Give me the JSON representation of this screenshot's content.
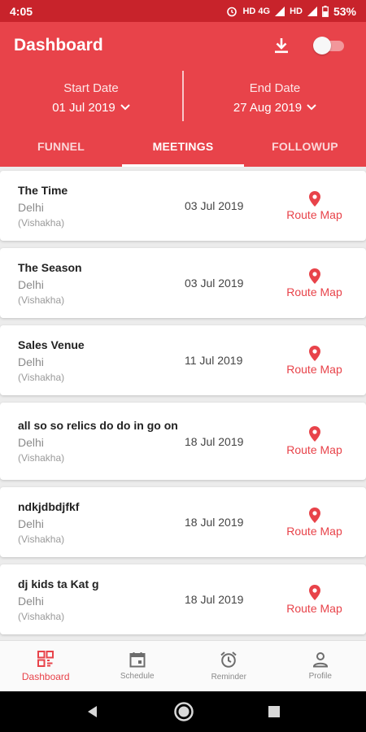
{
  "status_bar": {
    "time": "4:05",
    "network_label": "HD 4G",
    "network_label2": "HD",
    "battery": "53%"
  },
  "header": {
    "title": "Dashboard",
    "start_date": {
      "label": "Start Date",
      "value": "01 Jul 2019"
    },
    "end_date": {
      "label": "End Date",
      "value": "27 Aug 2019"
    }
  },
  "tabs": [
    {
      "label": "FUNNEL",
      "active": false
    },
    {
      "label": "MEETINGS",
      "active": true
    },
    {
      "label": "FOLLOWUP",
      "active": false
    }
  ],
  "meetings": [
    {
      "name": "The Time",
      "city": "Delhi",
      "person": "(Vishakha)",
      "date": "03 Jul 2019",
      "action": "Route Map"
    },
    {
      "name": "The Season",
      "city": "Delhi",
      "person": "(Vishakha)",
      "date": "03 Jul 2019",
      "action": "Route Map"
    },
    {
      "name": "Sales Venue",
      "city": "Delhi",
      "person": "(Vishakha)",
      "date": "11 Jul 2019",
      "action": "Route Map"
    },
    {
      "name": "all so so relics do do in go on",
      "city": "Delhi",
      "person": "(Vishakha)",
      "date": "18 Jul 2019",
      "action": "Route Map"
    },
    {
      "name": "ndkjdbdjfkf",
      "city": "Delhi",
      "person": "(Vishakha)",
      "date": "18 Jul 2019",
      "action": "Route Map"
    },
    {
      "name": "dj kids ta Kat g",
      "city": "Delhi",
      "person": "(Vishakha)",
      "date": "18 Jul 2019",
      "action": "Route Map"
    }
  ],
  "bottom_nav": [
    {
      "label": "Dashboard",
      "icon": "dashboard-icon",
      "active": true
    },
    {
      "label": "Schedule",
      "icon": "calendar-icon",
      "active": false
    },
    {
      "label": "Reminder",
      "icon": "alarm-clock-icon",
      "active": false
    },
    {
      "label": "Profile",
      "icon": "person-icon",
      "active": false
    }
  ],
  "colors": {
    "primary": "#e8434a",
    "status_bar": "#c8232b"
  }
}
